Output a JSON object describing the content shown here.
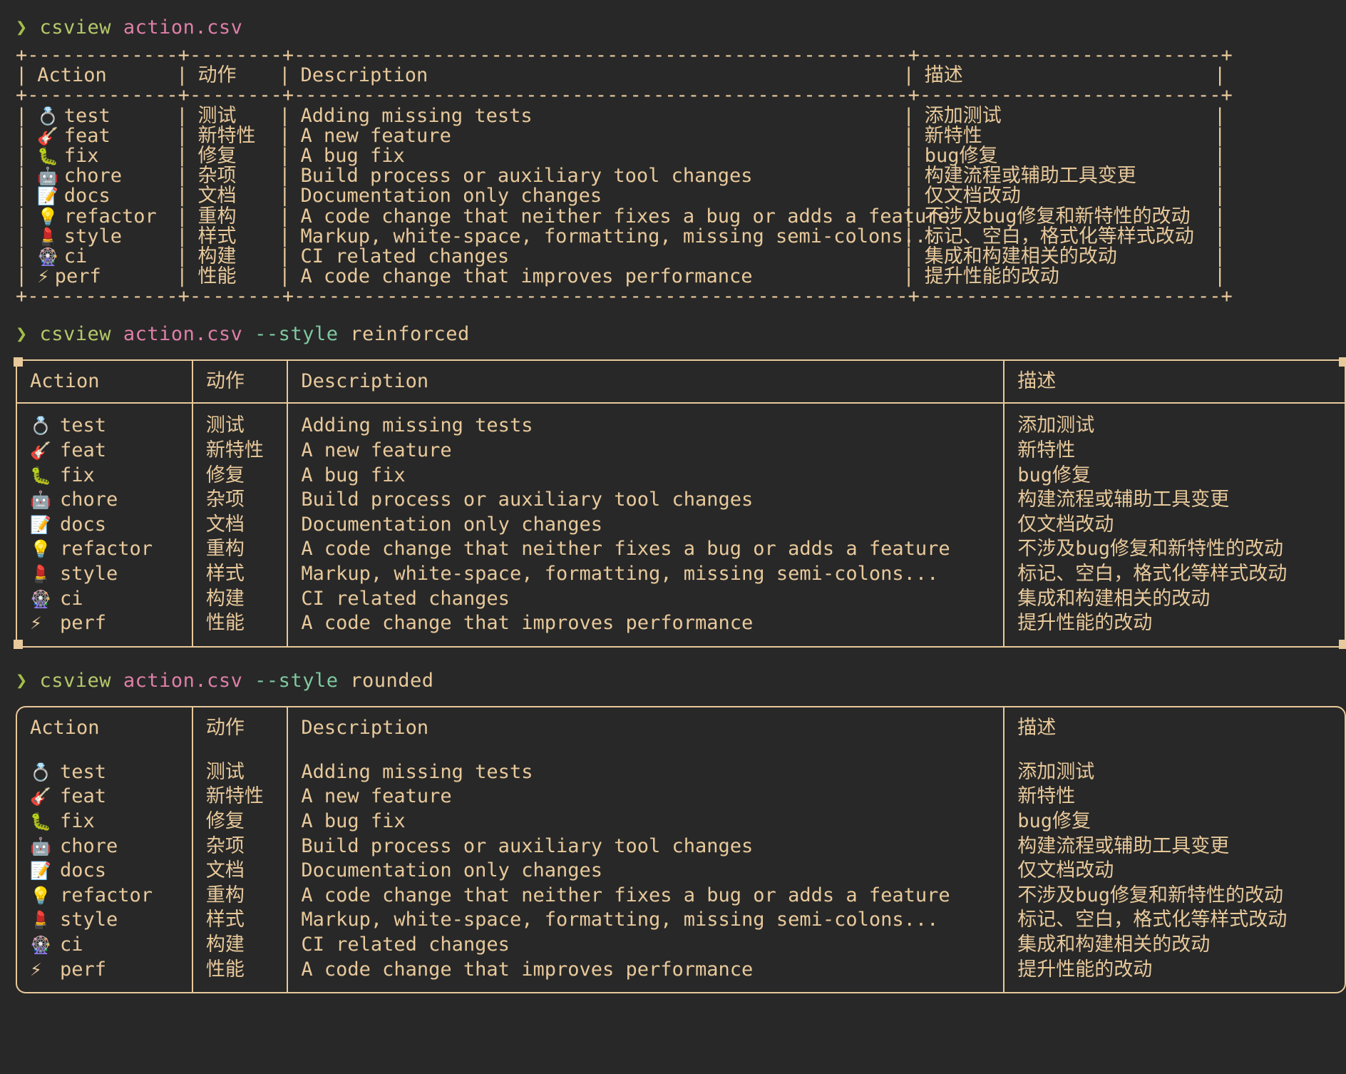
{
  "terminal": {
    "background": "#282828",
    "foreground": "#e8c99b",
    "prompt_symbol": "❯",
    "accent_command": "#b5c86a",
    "accent_file": "#df7fa8",
    "accent_flag": "#7fc9a0",
    "border_color": "#e8c99b"
  },
  "commands": [
    {
      "id": "cmd1",
      "program": "csview",
      "file": "action.csv",
      "flag": "",
      "value": "",
      "style": "ascii"
    },
    {
      "id": "cmd2",
      "program": "csview",
      "file": "action.csv",
      "flag": "--style",
      "value": "reinforced",
      "style": "reinforced"
    },
    {
      "id": "cmd3",
      "program": "csview",
      "file": "action.csv",
      "flag": "--style",
      "value": "rounded",
      "style": "rounded"
    }
  ],
  "table": {
    "headers": [
      "Action",
      "动作",
      "Description",
      "描述"
    ],
    "rows": [
      {
        "emoji": "💍",
        "emoji_name": "ring-icon",
        "action": "test",
        "action_cn": "测试",
        "description": "Adding missing tests",
        "description_cn": "添加测试"
      },
      {
        "emoji": "🎸",
        "emoji_name": "guitar-icon",
        "action": "feat",
        "action_cn": "新特性",
        "description": "A new feature",
        "description_cn": "新特性"
      },
      {
        "emoji": "🐛",
        "emoji_name": "bug-icon",
        "action": "fix",
        "action_cn": "修复",
        "description": "A bug fix",
        "description_cn": "bug修复"
      },
      {
        "emoji": "🤖",
        "emoji_name": "robot-icon",
        "action": "chore",
        "action_cn": "杂项",
        "description": "Build process or auxiliary tool changes",
        "description_cn": "构建流程或辅助工具变更"
      },
      {
        "emoji": "📝",
        "emoji_name": "memo-icon",
        "action": "docs",
        "action_cn": "文档",
        "description": "Documentation only changes",
        "description_cn": "仅文档改动"
      },
      {
        "emoji": "💡",
        "emoji_name": "lightbulb-icon",
        "action": "refactor",
        "action_cn": "重构",
        "description": "A code change that neither fixes a bug or adds a feature",
        "description_cn": "不涉及bug修复和新特性的改动"
      },
      {
        "emoji": "💄",
        "emoji_name": "lipstick-icon",
        "action": "style",
        "action_cn": "样式",
        "description": "Markup, white-space, formatting, missing semi-colons...",
        "description_cn": "标记、空白，格式化等样式改动"
      },
      {
        "emoji": "🎡",
        "emoji_name": "ferris-wheel-icon",
        "action": "ci",
        "action_cn": "构建",
        "description": "CI related changes",
        "description_cn": "集成和构建相关的改动"
      },
      {
        "emoji": "⚡",
        "emoji_name": "lightning-icon",
        "action": "perf",
        "action_cn": "性能",
        "description": "A code change that improves performance",
        "description_cn": "提升性能的改动"
      }
    ]
  },
  "ascii_art": {
    "rule": "+-------------+--------+-----------------------------------------------------+--------------------------+",
    "vbar": "|"
  }
}
